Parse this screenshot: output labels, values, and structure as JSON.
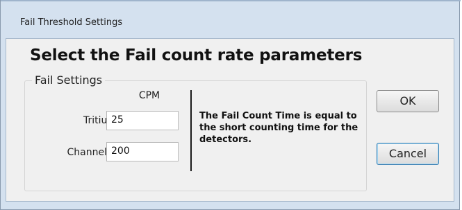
{
  "window": {
    "title": "Fail Threshold Settings"
  },
  "dialog": {
    "heading": "Select the Fail count rate parameters",
    "group_title": "Fail Settings",
    "column_header": "CPM",
    "rows": [
      {
        "label": "Tritium",
        "value": "25"
      },
      {
        "label": "Channel B",
        "value": "200"
      }
    ],
    "note": "The Fail Count Time is equal to the short counting time for the detectors.",
    "ok_label": "OK",
    "cancel_label": "Cancel"
  }
}
